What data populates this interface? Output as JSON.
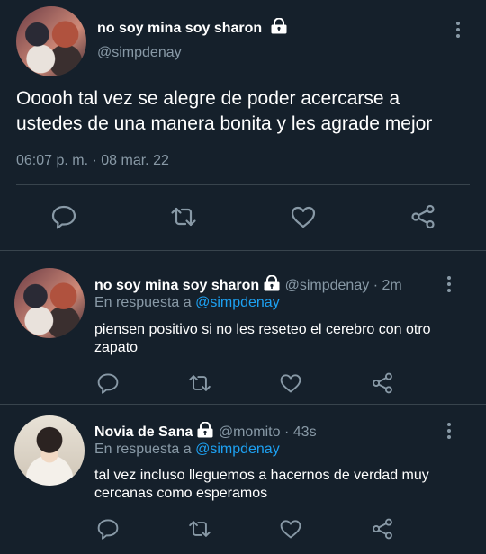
{
  "main_tweet": {
    "name": "no soy mina soy sharon",
    "handle": "@simpdenay",
    "text": "Ooooh tal vez se alegre de poder acercarse a ustedes de una manera bonita y les agrade mejor",
    "timestamp": "06:07 p. m. · 08 mar. 22"
  },
  "replies": [
    {
      "name": "no soy mina soy sharon",
      "handle": "@simpdenay",
      "sep": "·",
      "age": "2m",
      "reply_prefix": "En respuesta a",
      "reply_to": "@simpdenay",
      "text": "piensen positivo si no les reseteo el cerebro con otro zapato"
    },
    {
      "name": "Novia de Sana",
      "handle": "@momito",
      "sep": "·",
      "age": "43s",
      "reply_prefix": "En respuesta a",
      "reply_to": "@simpdenay",
      "text": "tal vez incluso lleguemos a hacernos de verdad muy cercanas como esperamos"
    }
  ],
  "icons": [
    "lock-icon",
    "more-icon",
    "reply-icon",
    "retweet-icon",
    "like-icon",
    "share-icon"
  ],
  "colors": {
    "background": "#15202b",
    "muted": "#8899a6",
    "link": "#1da1f2",
    "divider": "#38444d"
  }
}
